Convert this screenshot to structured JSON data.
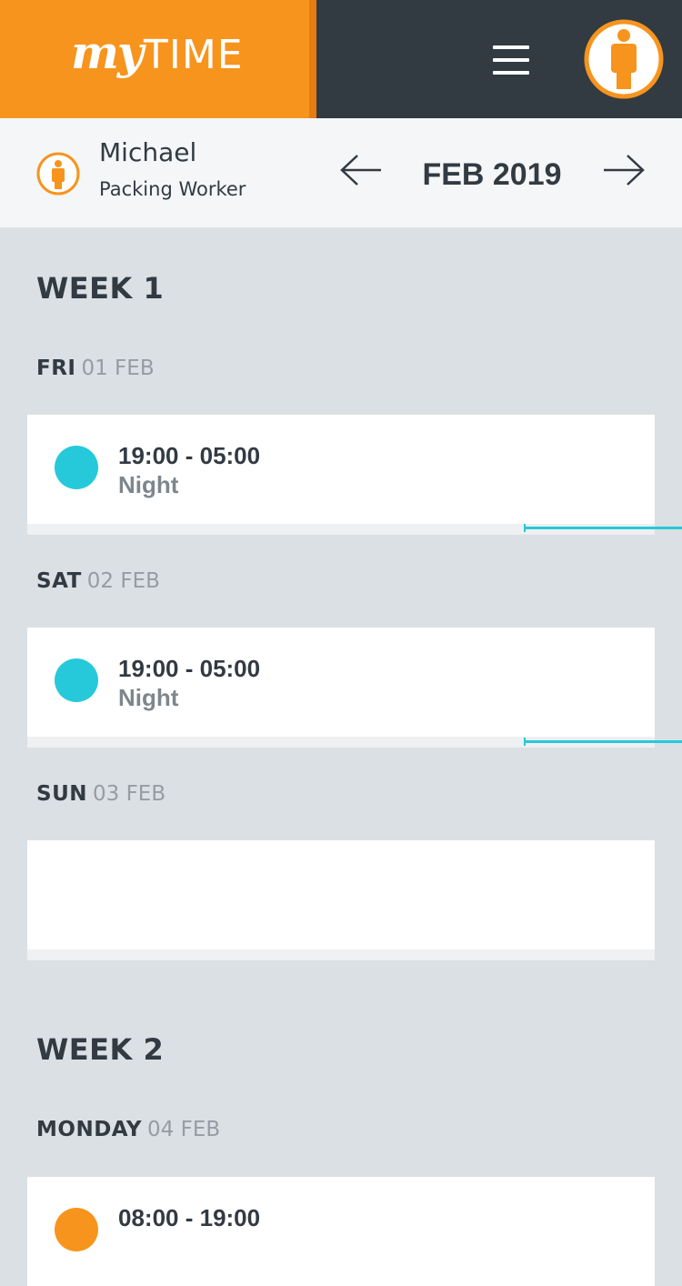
{
  "app": {
    "logo_my": "my",
    "logo_time": "TIME",
    "menu_icon": "hamburger-menu-icon",
    "profile_icon": "person-icon"
  },
  "user": {
    "name": "Michael",
    "role": "Packing Worker"
  },
  "nav": {
    "month": "FEB 2019",
    "prev_icon": "arrow-left-icon",
    "next_icon": "arrow-right-icon"
  },
  "colors": {
    "brand_orange": "#f7941d",
    "header_dark": "#323a42",
    "night_shift": "#26c9d9",
    "day_shift": "#f7941d"
  },
  "weeks": [
    {
      "title": "WEEK 1",
      "days": [
        {
          "weekday": "FRI",
          "date": "01 FEB",
          "shift": {
            "time": "19:00 - 05:00",
            "name": "Night"
          }
        },
        {
          "weekday": "SAT",
          "date": "02 FEB",
          "shift": {
            "time": "19:00 - 05:00",
            "name": "Night"
          }
        },
        {
          "weekday": "SUN",
          "date": "03 FEB",
          "shift": null
        }
      ]
    },
    {
      "title": "WEEK 2",
      "days": [
        {
          "weekday": "MONDAY",
          "date": "04 FEB",
          "shift": {
            "time": "08:00 - 19:00",
            "name": ""
          }
        }
      ]
    }
  ]
}
